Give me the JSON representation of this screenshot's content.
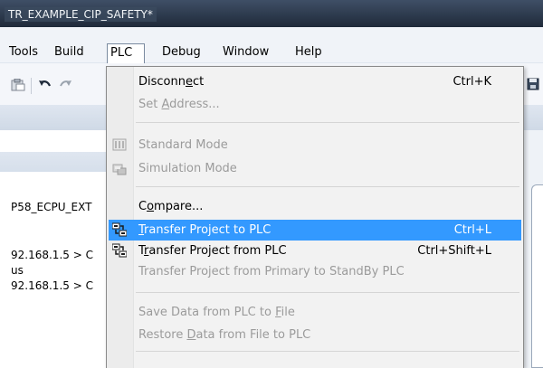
{
  "window": {
    "title": "TR_EXAMPLE_CIP_SAFETY*"
  },
  "menubar": {
    "items": [
      {
        "label": "Tools"
      },
      {
        "label": "Build"
      },
      {
        "label": "PLC"
      },
      {
        "label": "Debug"
      },
      {
        "label": "Window"
      },
      {
        "label": "Help"
      }
    ]
  },
  "left_panel": {
    "lines": [
      "P58_ECPU_EXT",
      "92.168.1.5 > C",
      "us",
      "92.168.1.5 > C"
    ]
  },
  "plc_menu": {
    "items": [
      {
        "pre": "Disconn",
        "ul": "e",
        "post": "ct",
        "shortcut": "Ctrl+K",
        "enabled": true,
        "icon": ""
      },
      {
        "pre": "Set ",
        "ul": "A",
        "post": "ddress...",
        "shortcut": "",
        "enabled": false,
        "icon": ""
      },
      {
        "pre": "Standard Mode",
        "ul": "",
        "post": "",
        "shortcut": "",
        "enabled": false,
        "icon": "standard-mode-icon"
      },
      {
        "pre": "Simulation Mode",
        "ul": "",
        "post": "",
        "shortcut": "",
        "enabled": false,
        "icon": "simulation-mode-icon"
      },
      {
        "pre": "C",
        "ul": "o",
        "post": "mpare...",
        "shortcut": "",
        "enabled": true,
        "icon": ""
      },
      {
        "pre": "",
        "ul": "T",
        "post": "ransfer Project to PLC",
        "shortcut": "Ctrl+L",
        "enabled": true,
        "highlighted": true,
        "icon": "transfer-icon"
      },
      {
        "pre": "T",
        "ul": "r",
        "post": "ansfer Project from PLC",
        "shortcut": "Ctrl+Shift+L",
        "enabled": true,
        "icon": "transfer-icon"
      },
      {
        "pre": "Transfer Project from Primary to StandBy PLC",
        "ul": "",
        "post": "",
        "shortcut": "",
        "enabled": false,
        "icon": ""
      },
      {
        "pre": "Save Data from PLC to ",
        "ul": "F",
        "post": "ile",
        "shortcut": "",
        "enabled": false,
        "icon": ""
      },
      {
        "pre": "Restore ",
        "ul": "D",
        "post": "ata from File to PLC",
        "shortcut": "",
        "enabled": false,
        "icon": ""
      }
    ]
  },
  "colors": {
    "highlight": "#3399ff",
    "titlebar": "#1f2a3a",
    "disabled_text": "#9b9b9b"
  }
}
